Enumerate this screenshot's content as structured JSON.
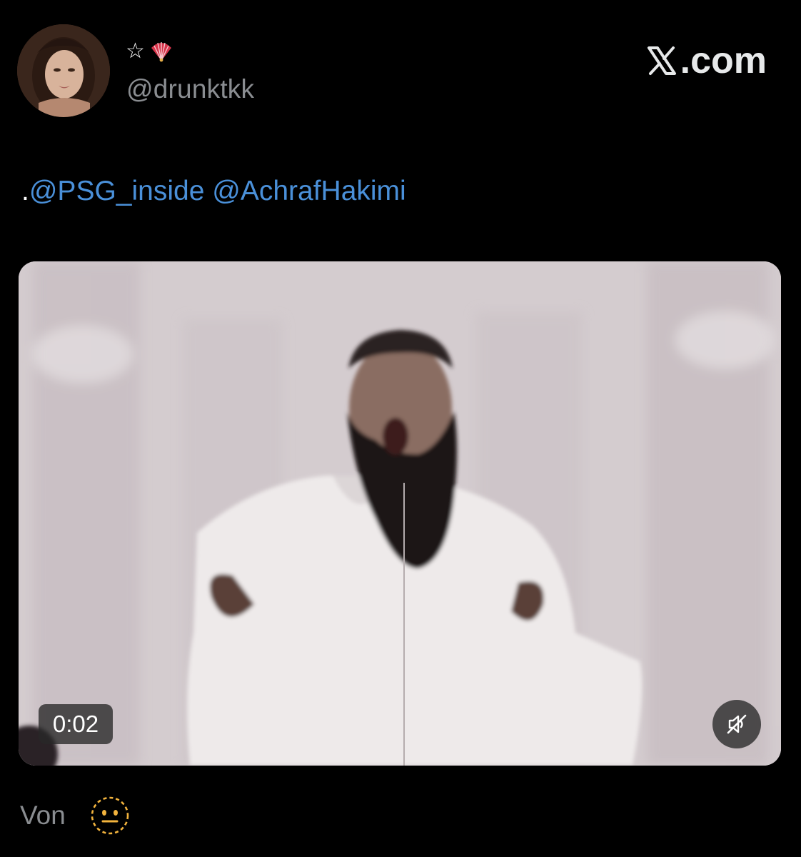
{
  "header": {
    "display_name_icons": [
      "star-outline-icon",
      "folding-fan-icon"
    ],
    "star_glyph": "☆",
    "handle": "@drunktkk",
    "brand_text": ".com",
    "brand_icon": "x-logo-icon"
  },
  "tweet": {
    "prefix": ".",
    "mentions": [
      "@PSG_inside",
      "@AchrafHakimi"
    ]
  },
  "video": {
    "time": "0:02",
    "mute_icon": "speaker-muted-icon"
  },
  "footer": {
    "label": "Von",
    "icon": "dotted-neutral-face-icon"
  },
  "colors": {
    "background": "#000000",
    "mention": "#4a90d9",
    "secondary_text": "#8a8d91",
    "brand_text": "#e7e9ea"
  }
}
